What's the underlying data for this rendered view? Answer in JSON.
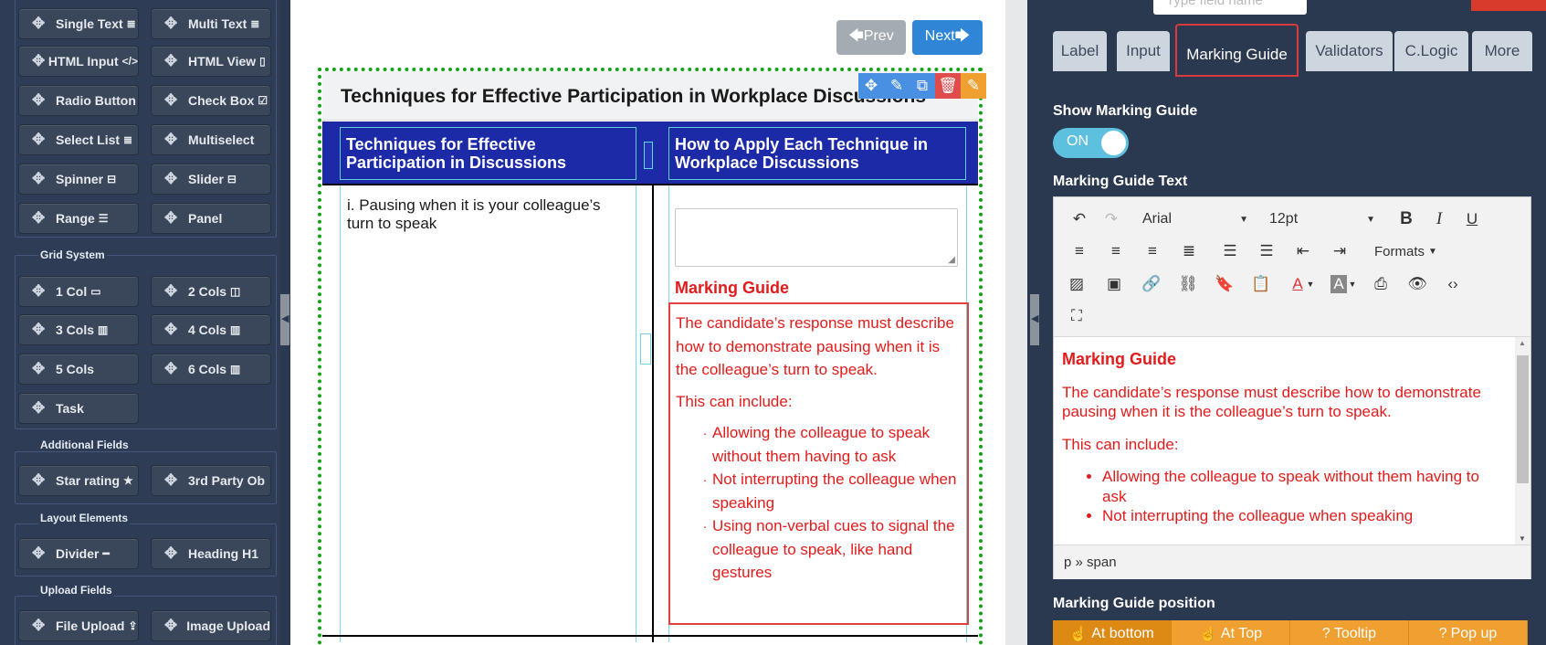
{
  "palette": {
    "tools_top": [
      {
        "label": "Single Text",
        "icon": "≣"
      },
      {
        "label": "Multi Text",
        "icon": "≣"
      },
      {
        "label": "HTML Input",
        "icon": "</>"
      },
      {
        "label": "HTML View",
        "icon": "▯"
      },
      {
        "label": "Radio Button",
        "icon": ""
      },
      {
        "label": "Check Box",
        "icon": "☑"
      },
      {
        "label": "Select List",
        "icon": "≣"
      },
      {
        "label": "Multiselect",
        "icon": ""
      },
      {
        "label": "Spinner",
        "icon": "⊟"
      },
      {
        "label": "Slider",
        "icon": "⊟"
      },
      {
        "label": "Range",
        "icon": "☰"
      },
      {
        "label": "Panel",
        "icon": ""
      }
    ],
    "grid_title": "Grid System",
    "grid_tools": [
      {
        "label": "1 Col",
        "icon": "▭"
      },
      {
        "label": "2 Cols",
        "icon": "◫"
      },
      {
        "label": "3 Cols",
        "icon": "▥"
      },
      {
        "label": "4 Cols",
        "icon": "▥"
      },
      {
        "label": "5 Cols",
        "icon": ""
      },
      {
        "label": "6 Cols",
        "icon": "▥"
      },
      {
        "label": "Task",
        "icon": ""
      }
    ],
    "additional_title": "Additional Fields",
    "additional_tools": [
      {
        "label": "Star rating",
        "icon": "★"
      },
      {
        "label": "3rd Party Ob",
        "icon": ""
      }
    ],
    "layout_title": "Layout Elements",
    "layout_tools": [
      {
        "label": "Divider",
        "icon": "━"
      },
      {
        "label": "Heading H1",
        "icon": ""
      }
    ],
    "upload_title": "Upload Fields",
    "upload_tools": [
      {
        "label": "File Upload",
        "icon": "⇪"
      },
      {
        "label": "Image Upload",
        "icon": ""
      }
    ]
  },
  "canvas": {
    "prev_label": "🡄Prev",
    "next_label": "Next🡆",
    "question_title": "Techniques for Effective Participation in Workplace Discussions",
    "col1_header": "Techniques for Effective Participation in Discussions",
    "col2_header": "How to Apply Each Technique in Workplace Discussions",
    "row1_technique": "i. Pausing when it is your colleague’s turn to speak",
    "marking_guide_title": "Marking Guide",
    "mg_para1": "The candidate’s response must describe how to demonstrate pausing when it is the colleague’s turn to speak.",
    "mg_para2": "This can include:",
    "mg_items": [
      "Allowing the colleague to speak without them having to ask",
      "Not interrupting the colleague when speaking",
      "Using non-verbal cues to signal the colleague to speak, like hand gestures"
    ]
  },
  "field_toolbar": [
    {
      "name": "move-icon",
      "glyph": "✥",
      "color": "#4a90e2"
    },
    {
      "name": "edit-icon",
      "glyph": "✎",
      "color": "#4a90e2"
    },
    {
      "name": "copy-icon",
      "glyph": "⧉",
      "color": "#4a90e2"
    },
    {
      "name": "delete-icon",
      "glyph": "🗑",
      "color": "#e04b4b"
    },
    {
      "name": "edit-alt-icon",
      "glyph": "✎",
      "color": "#f0a030"
    }
  ],
  "right_panel": {
    "field_name_placeholder": "Type field name",
    "tabs": [
      {
        "label": "Label",
        "active": false
      },
      {
        "label": "Input",
        "active": false
      },
      {
        "label": "Marking Guide",
        "active": true
      },
      {
        "label": "Validators",
        "active": false
      },
      {
        "label": "C.Logic",
        "active": false
      },
      {
        "label": "More",
        "active": false
      }
    ],
    "show_mg_label": "Show Marking Guide",
    "toggle_label": "ON",
    "mg_text_label": "Marking Guide Text",
    "editor": {
      "font": "Arial",
      "size": "12pt",
      "formats": "Formats",
      "heading": "Marking Guide",
      "para1": "The candidate’s response must describe how to demonstrate pausing when it is the colleague’s turn to speak.",
      "para2": "This can include:",
      "items": [
        "Allowing the colleague to speak without them having to ask",
        "Not interrupting the colleague when speaking"
      ],
      "status_path": "p » span"
    },
    "position_label": "Marking Guide position",
    "positions": [
      {
        "label": "At bottom",
        "icon": "☝",
        "active": true
      },
      {
        "label": "At Top",
        "icon": "☝",
        "active": false
      },
      {
        "label": "Tooltip",
        "icon": "?",
        "active": false
      },
      {
        "label": "Pop up",
        "icon": "?",
        "active": false
      }
    ]
  }
}
